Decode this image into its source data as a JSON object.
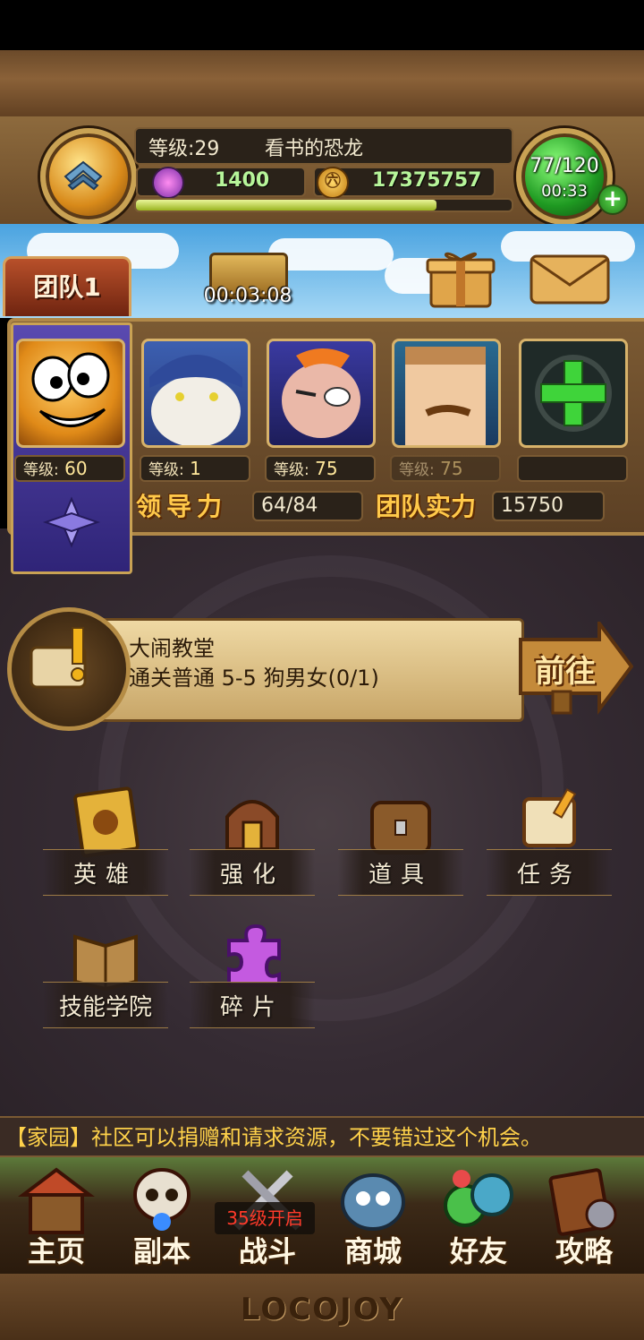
{
  "player": {
    "level_text": "等级:29",
    "name": "看书的恐龙",
    "gems": "1400",
    "gold": "17375757",
    "coin_glyph": "㊅",
    "xp_fraction": 0.8,
    "energy": "77/120",
    "energy_timer": "00:33"
  },
  "header": {
    "team_tab": "团队1",
    "chest_timer": "00:03:08"
  },
  "team": {
    "slots": [
      {
        "level_label": "等级:",
        "level": "60",
        "active": true
      },
      {
        "level_label": "等级:",
        "level": "1",
        "active": true
      },
      {
        "level_label": "等级:",
        "level": "75",
        "active": true
      },
      {
        "level_label": "等级:",
        "level": "75",
        "active": false
      },
      {
        "level_label": "",
        "level": "",
        "active": false
      }
    ],
    "leadership_label": "领导力",
    "leadership_value": "64/84",
    "power_label": "团队实力",
    "power_value": "15750"
  },
  "quest": {
    "title": "大闹教堂",
    "description": "通关普通 5-5 狗男女(0/1)",
    "go_label": "前往"
  },
  "menu": [
    {
      "label": "英雄",
      "icon": "hero-book-icon"
    },
    {
      "label": "强化",
      "icon": "enhance-helmet-icon"
    },
    {
      "label": "道具",
      "icon": "items-bag-icon"
    },
    {
      "label": "任务",
      "icon": "quest-scroll-icon"
    },
    {
      "label": "技能学院",
      "icon": "skill-book-icon"
    },
    {
      "label": "碎片",
      "icon": "puzzle-piece-icon"
    }
  ],
  "announcement": "【家园】社区可以捐赠和请求资源，不要错过这个机会。",
  "nav": [
    {
      "label": "主页",
      "icon": "house-icon"
    },
    {
      "label": "副本",
      "icon": "skull-icon"
    },
    {
      "label": "战斗",
      "icon": "swords-icon"
    },
    {
      "label": "商城",
      "icon": "monster-shop-icon"
    },
    {
      "label": "好友",
      "icon": "friends-icon"
    },
    {
      "label": "攻略",
      "icon": "guide-book-icon"
    }
  ],
  "lock_badge": "35级开启",
  "logo": "LOCOJOY"
}
